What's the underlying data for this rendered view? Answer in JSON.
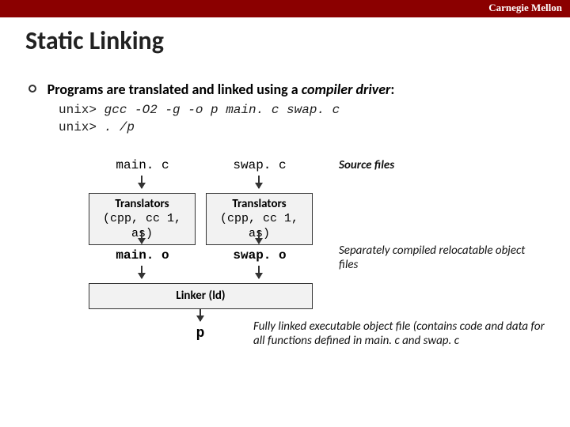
{
  "brand": "Carnegie Mellon",
  "title": "Static Linking",
  "bullet": {
    "prefix": "Programs are translated and linked using a ",
    "driver": "compiler driver",
    "suffix": ":"
  },
  "code": {
    "prompt1": "unix> ",
    "cmd1": "gcc -O2 -g -o p main. c swap. c",
    "prompt2": "unix> ",
    "cmd2": ". /p"
  },
  "src1": "main. c",
  "src2": "swap. c",
  "annotSrc": "Source files",
  "translators": {
    "head": "Translators",
    "sub": "(cpp, cc 1, as)"
  },
  "obj1": "main. o",
  "obj2": "swap. o",
  "annotObj": "Separately compiled relocatable object files",
  "linker": "Linker (ld)",
  "exe": "p",
  "annotExe": "Fully linked executable object file (contains code and data for all functions defined in main. c and swap. c"
}
